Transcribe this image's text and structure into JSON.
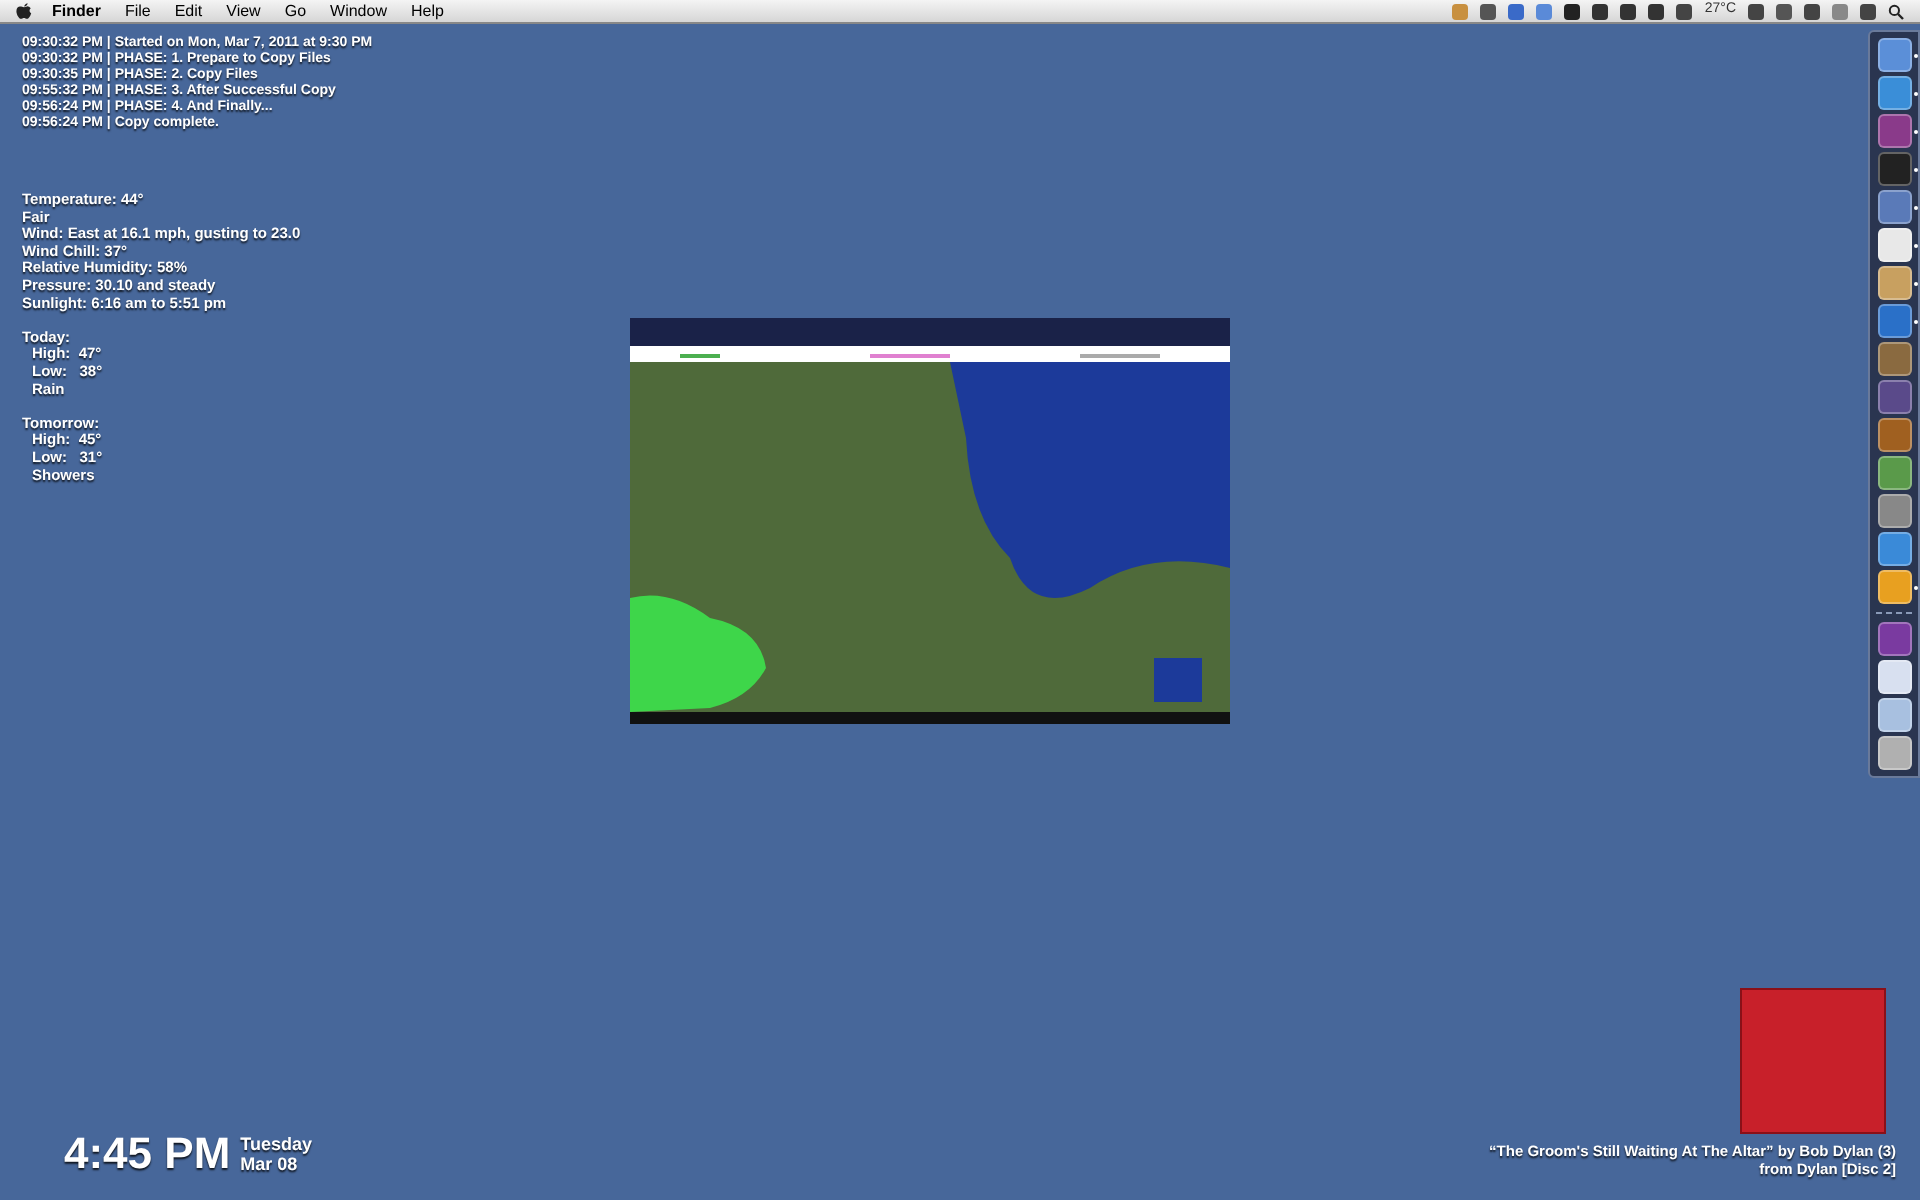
{
  "menu_bar": {
    "app_name": "Finder",
    "menus": [
      "File",
      "Edit",
      "View",
      "Go",
      "Window",
      "Help"
    ],
    "temperature": "27°C"
  },
  "log": [
    "09:30:32 PM | Started on Mon, Mar 7, 2011 at 9:30 PM",
    "09:30:32 PM | PHASE: 1. Prepare to Copy Files",
    "09:30:35 PM | PHASE: 2. Copy Files",
    "09:55:32 PM | PHASE: 3. After Successful Copy",
    "09:56:24 PM | PHASE: 4. And Finally...",
    "09:56:24 PM | Copy complete."
  ],
  "weather": {
    "current": [
      "Temperature: 44°",
      "Fair",
      "Wind: East at 16.1 mph, gusting to 23.0",
      "Wind Chill: 37°",
      "Relative Humidity: 58%",
      "Pressure: 30.10 and steady",
      "Sunlight: 6:16 am to 5:51 pm"
    ],
    "forecast": [
      {
        "day": "Today:",
        "lines": [
          "High:  47°",
          "Low:   38°",
          "Rain"
        ]
      },
      {
        "day": "Tomorrow:",
        "lines": [
          "High:  45°",
          "Low:   31°",
          "Showers"
        ]
      }
    ]
  },
  "dock": {
    "apps": [
      {
        "running": true
      },
      {
        "running": true
      },
      {
        "running": true
      },
      {
        "running": true
      },
      {
        "running": true
      },
      {
        "running": true
      },
      {
        "running": true
      },
      {
        "running": true
      },
      {
        "running": false
      },
      {
        "running": false
      },
      {
        "running": false
      },
      {
        "running": false
      },
      {
        "running": false
      },
      {
        "running": false
      },
      {
        "running": true
      }
    ],
    "documents": [
      {
        "running": false
      },
      {
        "running": false
      },
      {
        "running": false
      },
      {
        "running": false
      }
    ]
  },
  "clock": {
    "time": "4:45 PM",
    "weekday": "Tuesday",
    "date": "Mar 08"
  },
  "now_playing": {
    "line_1": "“The Groom's Still Waiting At The Altar” by Bob Dylan (3)",
    "line_2": "from Dylan [Disc 2]"
  }
}
